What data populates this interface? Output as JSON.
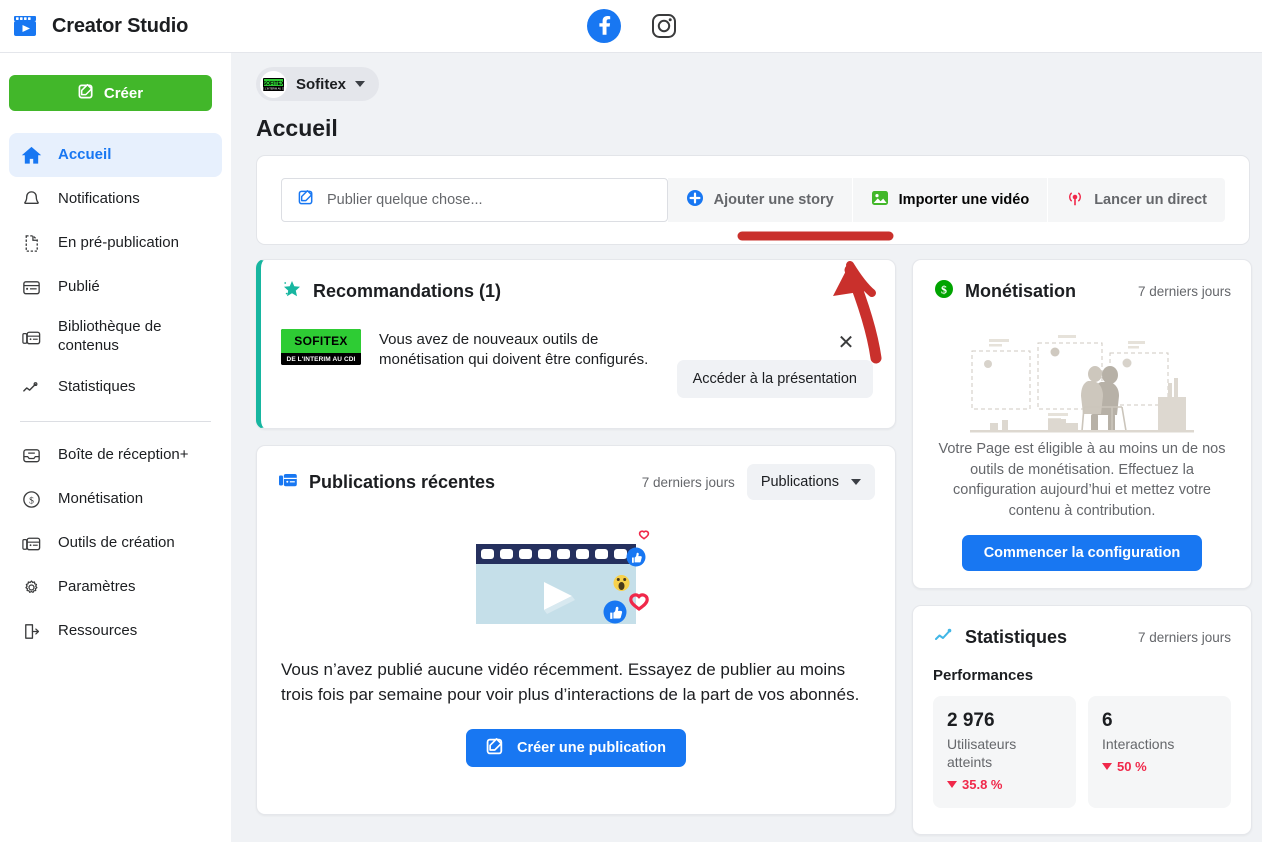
{
  "header": {
    "brand_title": "Creator Studio",
    "brand_icon": "clapperboard-icon",
    "facebook_icon": "facebook-icon",
    "instagram_icon": "instagram-icon"
  },
  "sidebar": {
    "create_button": "Créer",
    "create_icon": "compose-icon",
    "items": [
      {
        "label": "Accueil",
        "icon": "home-icon",
        "active": true
      },
      {
        "label": "Notifications",
        "icon": "bell-icon",
        "active": false
      },
      {
        "label": "En pré-publication",
        "icon": "document-icon",
        "active": false
      },
      {
        "label": "Publié",
        "icon": "card-icon",
        "active": false
      },
      {
        "label": "Bibliothèque de contenus",
        "icon": "library-icon",
        "active": false
      },
      {
        "label": "Statistiques",
        "icon": "chart-line-icon",
        "active": false
      }
    ],
    "items_secondary": [
      {
        "label": "Boîte de réception+",
        "icon": "inbox-icon"
      },
      {
        "label": "Monétisation",
        "icon": "dollar-circle-icon"
      },
      {
        "label": "Outils de création",
        "icon": "library-icon"
      },
      {
        "label": "Paramètres",
        "icon": "gear-icon"
      },
      {
        "label": "Ressources",
        "icon": "exit-doc-icon"
      }
    ]
  },
  "main": {
    "page_switcher": {
      "name": "Sofitex",
      "caret_icon": "chevron-down-icon",
      "avatar": "sofitex-avatar"
    },
    "page_title": "Accueil",
    "composer": {
      "placeholder": "Publier quelque chose...",
      "compose_icon": "compose-icon",
      "buttons": [
        {
          "label": "Ajouter une story",
          "icon": "plus-circle-icon",
          "emphasis": false
        },
        {
          "label": "Importer une vidéo",
          "icon": "image-upload-icon",
          "emphasis": true
        },
        {
          "label": "Lancer un direct",
          "icon": "live-broadcast-icon",
          "emphasis": false
        }
      ]
    },
    "recommendations": {
      "title": "Recommandations (1)",
      "icon": "star-icon",
      "accent_color": "#17b6a0",
      "logo_top": "SOFITEX",
      "logo_bottom": "DE L'INTERIM AU CDI",
      "message": "Vous avez de nouveaux outils de monétisation qui doivent être configurés.",
      "cta": "Accéder à la présentation",
      "close_icon": "close-icon"
    },
    "recent_posts": {
      "title": "Publications récentes",
      "icon": "library-icon",
      "period": "7 derniers jours",
      "filter_value": "Publications",
      "filter_caret": "chevron-down-icon",
      "empty_message": "Vous n’avez publié aucune vidéo récemment. Essayez de publier au moins trois fois par semaine pour voir plus d’interactions de la part de vos abonnés.",
      "cta": "Créer une publication",
      "cta_icon": "compose-icon",
      "art": "video-reactions-illustration"
    },
    "monetisation": {
      "title": "Monétisation",
      "icon": "dollar-circle-green-icon",
      "period": "7 derniers jours",
      "illustration": "person-at-desk-illustration",
      "message": "Votre Page est éligible à au moins un de nos outils de monétisation. Effectuez la configuration aujourd’hui et mettez votre contenu à contribution.",
      "cta": "Commencer la configuration"
    },
    "statistiques": {
      "title": "Statistiques",
      "icon": "chart-line-blue-icon",
      "period": "7 derniers jours",
      "section_label": "Performances",
      "tiles": [
        {
          "value": "2 976",
          "label": "Utilisateurs atteints",
          "delta": "35.8 %",
          "delta_direction": "down",
          "delta_color": "#f0284a"
        },
        {
          "value": "6",
          "label": "Interactions",
          "delta": "50 %",
          "delta_direction": "down",
          "delta_color": "#f0284a"
        }
      ]
    }
  },
  "annotation": {
    "type": "red-arrow-and-underline",
    "color": "#c9302c",
    "target": "Ajouter une story"
  }
}
